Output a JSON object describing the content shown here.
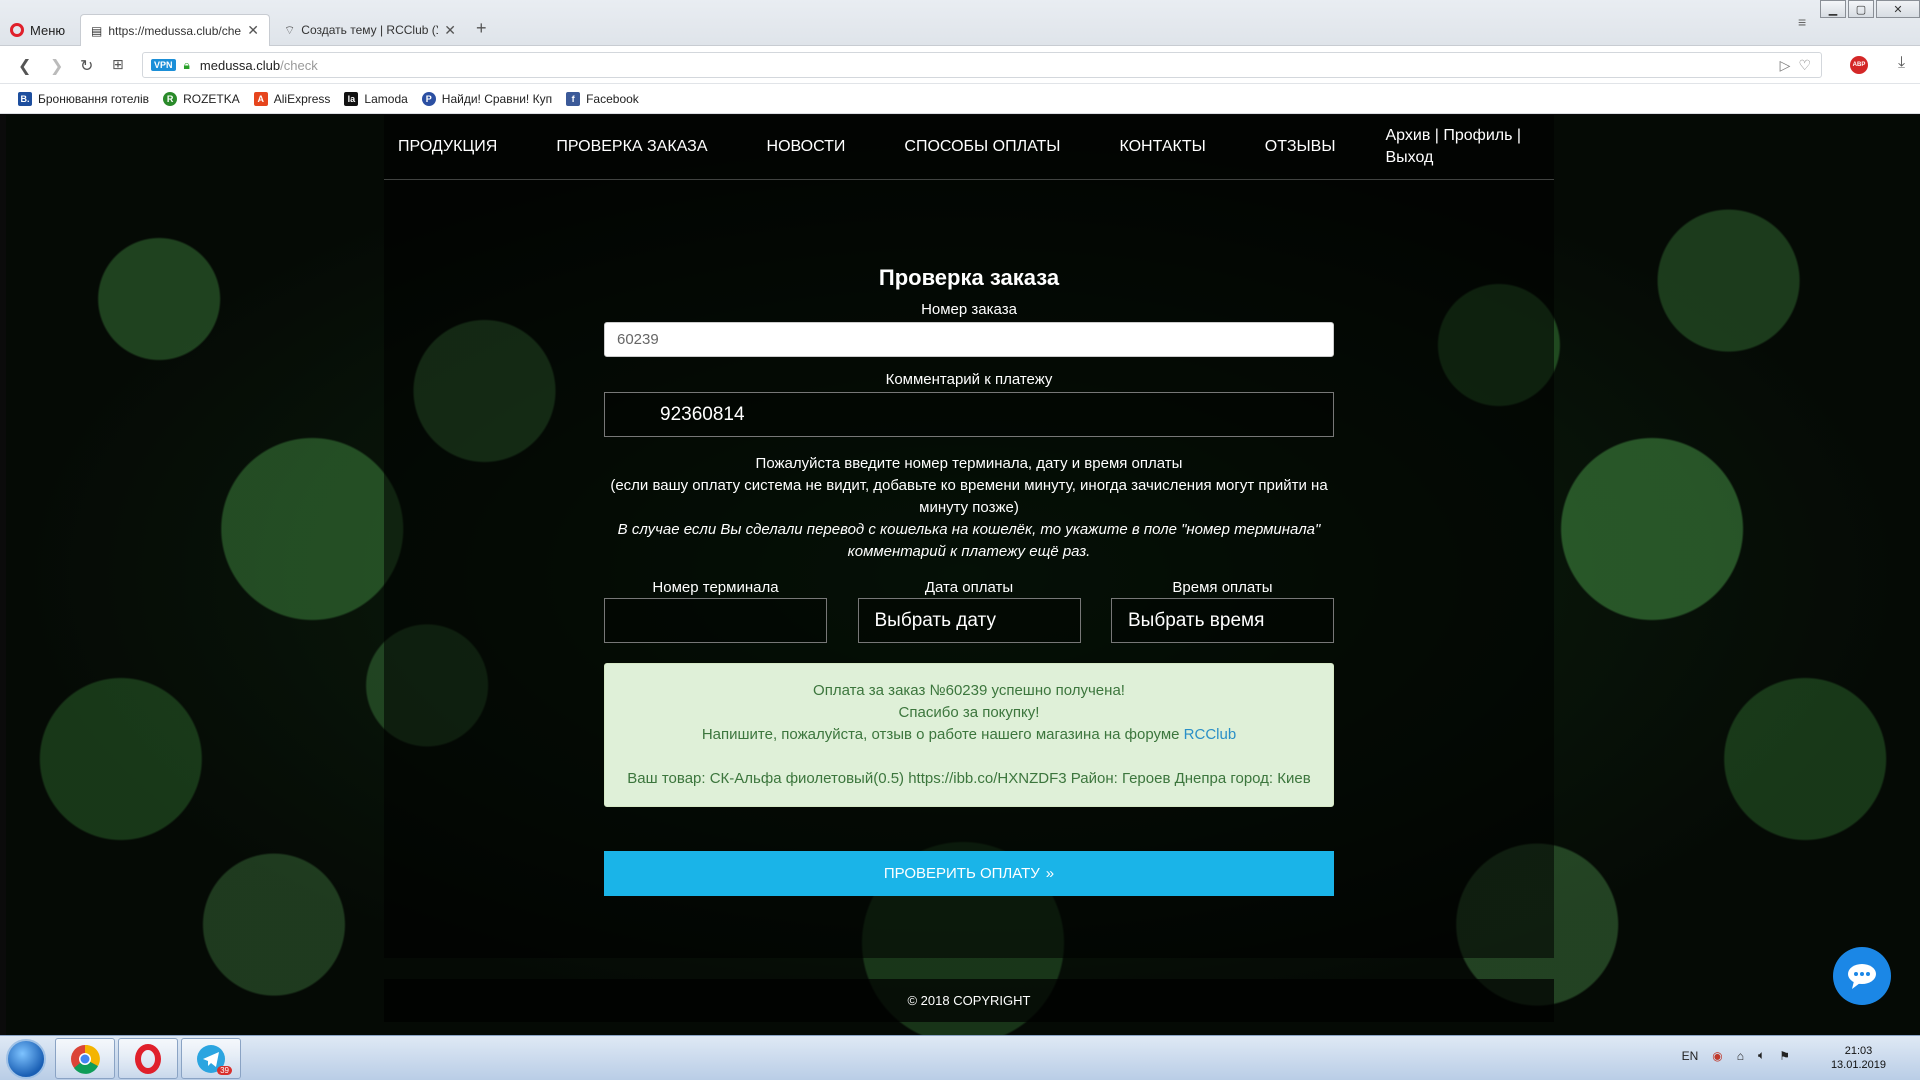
{
  "browser": {
    "menu_label": "Меню",
    "tabs": [
      {
        "title": "https://medussa.club/check"
      },
      {
        "title": "Создать тему | RCClub (У"
      }
    ],
    "address": {
      "domain": "medussa.club",
      "path": "/check"
    },
    "vpn_label": "VPN",
    "abp_label": "ABP",
    "bookmarks": [
      {
        "label": "Бронювання готелів",
        "icon": "B.",
        "color": "#1d4e9e"
      },
      {
        "label": "ROZETKA",
        "icon": "R",
        "color": "#2a8a2a"
      },
      {
        "label": "AliExpress",
        "icon": "A",
        "color": "#e6451d"
      },
      {
        "label": "Lamoda",
        "icon": "la",
        "color": "#111111"
      },
      {
        "label": "Найди! Сравни! Куп",
        "icon": "P",
        "color": "#2b4fa2"
      },
      {
        "label": "Facebook",
        "icon": "f",
        "color": "#3b5998"
      }
    ]
  },
  "site": {
    "nav": [
      "ПРОДУКЦИЯ",
      "ПРОВЕРКА ЗАКАЗА",
      "НОВОСТИ",
      "СПОСОБЫ ОПЛАТЫ",
      "КОНТАКТЫ",
      "ОТЗЫВЫ"
    ],
    "user_links": {
      "archive": "Архив",
      "profile": "Профиль",
      "logout": "Выход"
    },
    "form": {
      "title": "Проверка заказа",
      "order_label": "Номер заказа",
      "order_value": "60239",
      "comment_label": "Комментарий к платежу",
      "comment_value": "92360814",
      "info_line1": "Пожалуйста введите номер терминала, дату и время оплаты",
      "info_line2": "(если вашу оплату система не видит, добавьте ко времени минуту, иногда зачисления могут прийти на минуту позже)",
      "info_italic": "В случае если Вы сделали перевод с кошелька на кошелёк, то укажите в поле \"номер терминала\" комментарий к платежу ещё раз.",
      "terminal_label": "Номер терминала",
      "terminal_value": "",
      "date_label": "Дата оплаты",
      "date_value": "Выбрать дату",
      "time_label": "Время оплаты",
      "time_value": "Выбрать время",
      "success_line1": "Оплата за заказ №60239 успешно получена!",
      "success_line2": "Спасибо за покупку!",
      "success_line3": "Напишите, пожалуйста, отзыв о работе нашего магазина на форуме",
      "success_link": "RCClub",
      "product_line": "Ваш товар: СК-Альфа фиолетовый(0.5) https://ibb.co/HXNZDF3 Район: Героев Днепра город: Киев",
      "submit_label": "ПРОВЕРИТЬ ОПЛАТУ",
      "submit_icon": "»"
    },
    "footer": "© 2018 COPYRIGHT"
  },
  "taskbar": {
    "lang": "EN",
    "time": "21:03",
    "date": "13.01.2019",
    "telegram_badge": "39"
  },
  "colors": {
    "submit": "#1ab4e8",
    "success_bg": "#dff0d8",
    "success_text": "#3c763d",
    "link": "#2a8fc7",
    "chat": "#1b87e6"
  }
}
